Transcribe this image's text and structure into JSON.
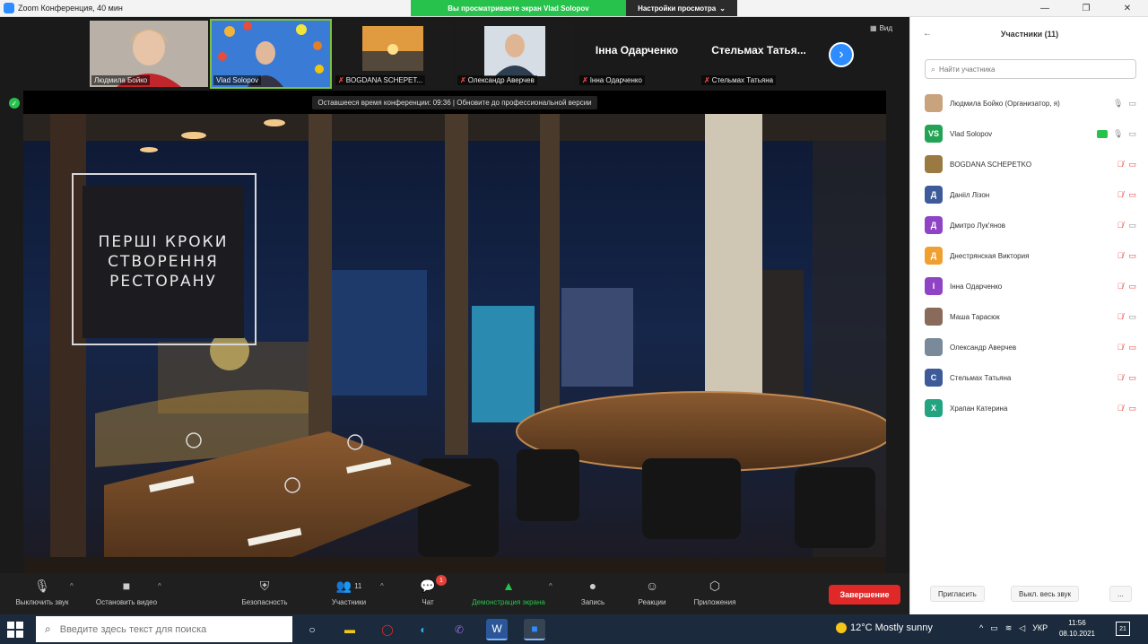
{
  "window": {
    "title": "Zoom Конференция, 40 мин"
  },
  "banner": {
    "sharing_text": "Вы просматриваете экран Vlad Solopov",
    "view_options_label": "Настройки просмотра"
  },
  "thumbnails": [
    {
      "label": "Людмила Бойко"
    },
    {
      "label": "Vlad Solopov"
    },
    {
      "label": "BOGDANA SCHEPET..."
    },
    {
      "label": "Олександр Аверчев"
    },
    {
      "label": "Інна Одарченко",
      "big_name": "Інна Одарченко"
    },
    {
      "label": "Стельмах Татьяна",
      "big_name": "Стельмах Татья..."
    }
  ],
  "view_label": "Вид",
  "timer_banner": "Оставшееся время конференции: 09:36 | Обновите до профессиональной версии",
  "slide": {
    "title": "ПЕРШІ КРОКИ СТВОРЕННЯ РЕСТОРАНУ"
  },
  "toolbar": {
    "mute_label": "Выключить звук",
    "video_label": "Остановить видео",
    "security_label": "Безопасность",
    "participants_label": "Участники",
    "participants_count": "11",
    "chat_label": "Чат",
    "chat_badge": "1",
    "share_label": "Демонстрация экрана",
    "record_label": "Запись",
    "reactions_label": "Реакции",
    "apps_label": "Приложения",
    "end_label": "Завершение"
  },
  "panel": {
    "title": "Участники (11)",
    "search_placeholder": "Найти участника",
    "participants": [
      {
        "name": "Людмила Бойко (Организатор, я)",
        "initials": "",
        "color": "#c9a27e",
        "muted": false,
        "cam_off": false
      },
      {
        "name": "Vlad Solopov",
        "initials": "VS",
        "color": "#23a455",
        "muted": false,
        "cam_off": false,
        "sharing": true
      },
      {
        "name": "BOGDANA SCHEPETKO",
        "initials": "",
        "color": "#9a7a40",
        "muted": true,
        "cam_off": true
      },
      {
        "name": "Данііл Лізон",
        "initials": "Д",
        "color": "#3d5a99",
        "muted": true,
        "cam_off": true
      },
      {
        "name": "Дмитро Лук'янов",
        "initials": "Д",
        "color": "#8e44c5",
        "muted": true,
        "cam_off": false
      },
      {
        "name": "Днестрянская Виктория",
        "initials": "Д",
        "color": "#f0a030",
        "muted": true,
        "cam_off": true
      },
      {
        "name": "Інна Одарченко",
        "initials": "І",
        "color": "#8e44c5",
        "muted": true,
        "cam_off": true
      },
      {
        "name": "Маша Тарасюк",
        "initials": "",
        "color": "#8a6a5a",
        "muted": true,
        "cam_off": false
      },
      {
        "name": "Олександр Аверчев",
        "initials": "",
        "color": "#7a8a9a",
        "muted": true,
        "cam_off": true
      },
      {
        "name": "Стельмах Татьяна",
        "initials": "С",
        "color": "#3d5a99",
        "muted": true,
        "cam_off": true
      },
      {
        "name": "Храпан Катерина",
        "initials": "Х",
        "color": "#23a480",
        "muted": true,
        "cam_off": true
      }
    ],
    "invite_label": "Пригласить",
    "mute_all_label": "Выкл. весь звук",
    "more_label": "..."
  },
  "taskbar": {
    "search_placeholder": "Введите здесь текст для поиска",
    "weather": "12°C Mostly sunny",
    "lang": "УКР",
    "time": "11:56",
    "date": "08.10.2021",
    "notifications": "21"
  },
  "colors": {
    "zoom_blue": "#2d8cff",
    "share_green": "#27c24c",
    "end_red": "#e02828",
    "muted_red": "#e5413c"
  }
}
